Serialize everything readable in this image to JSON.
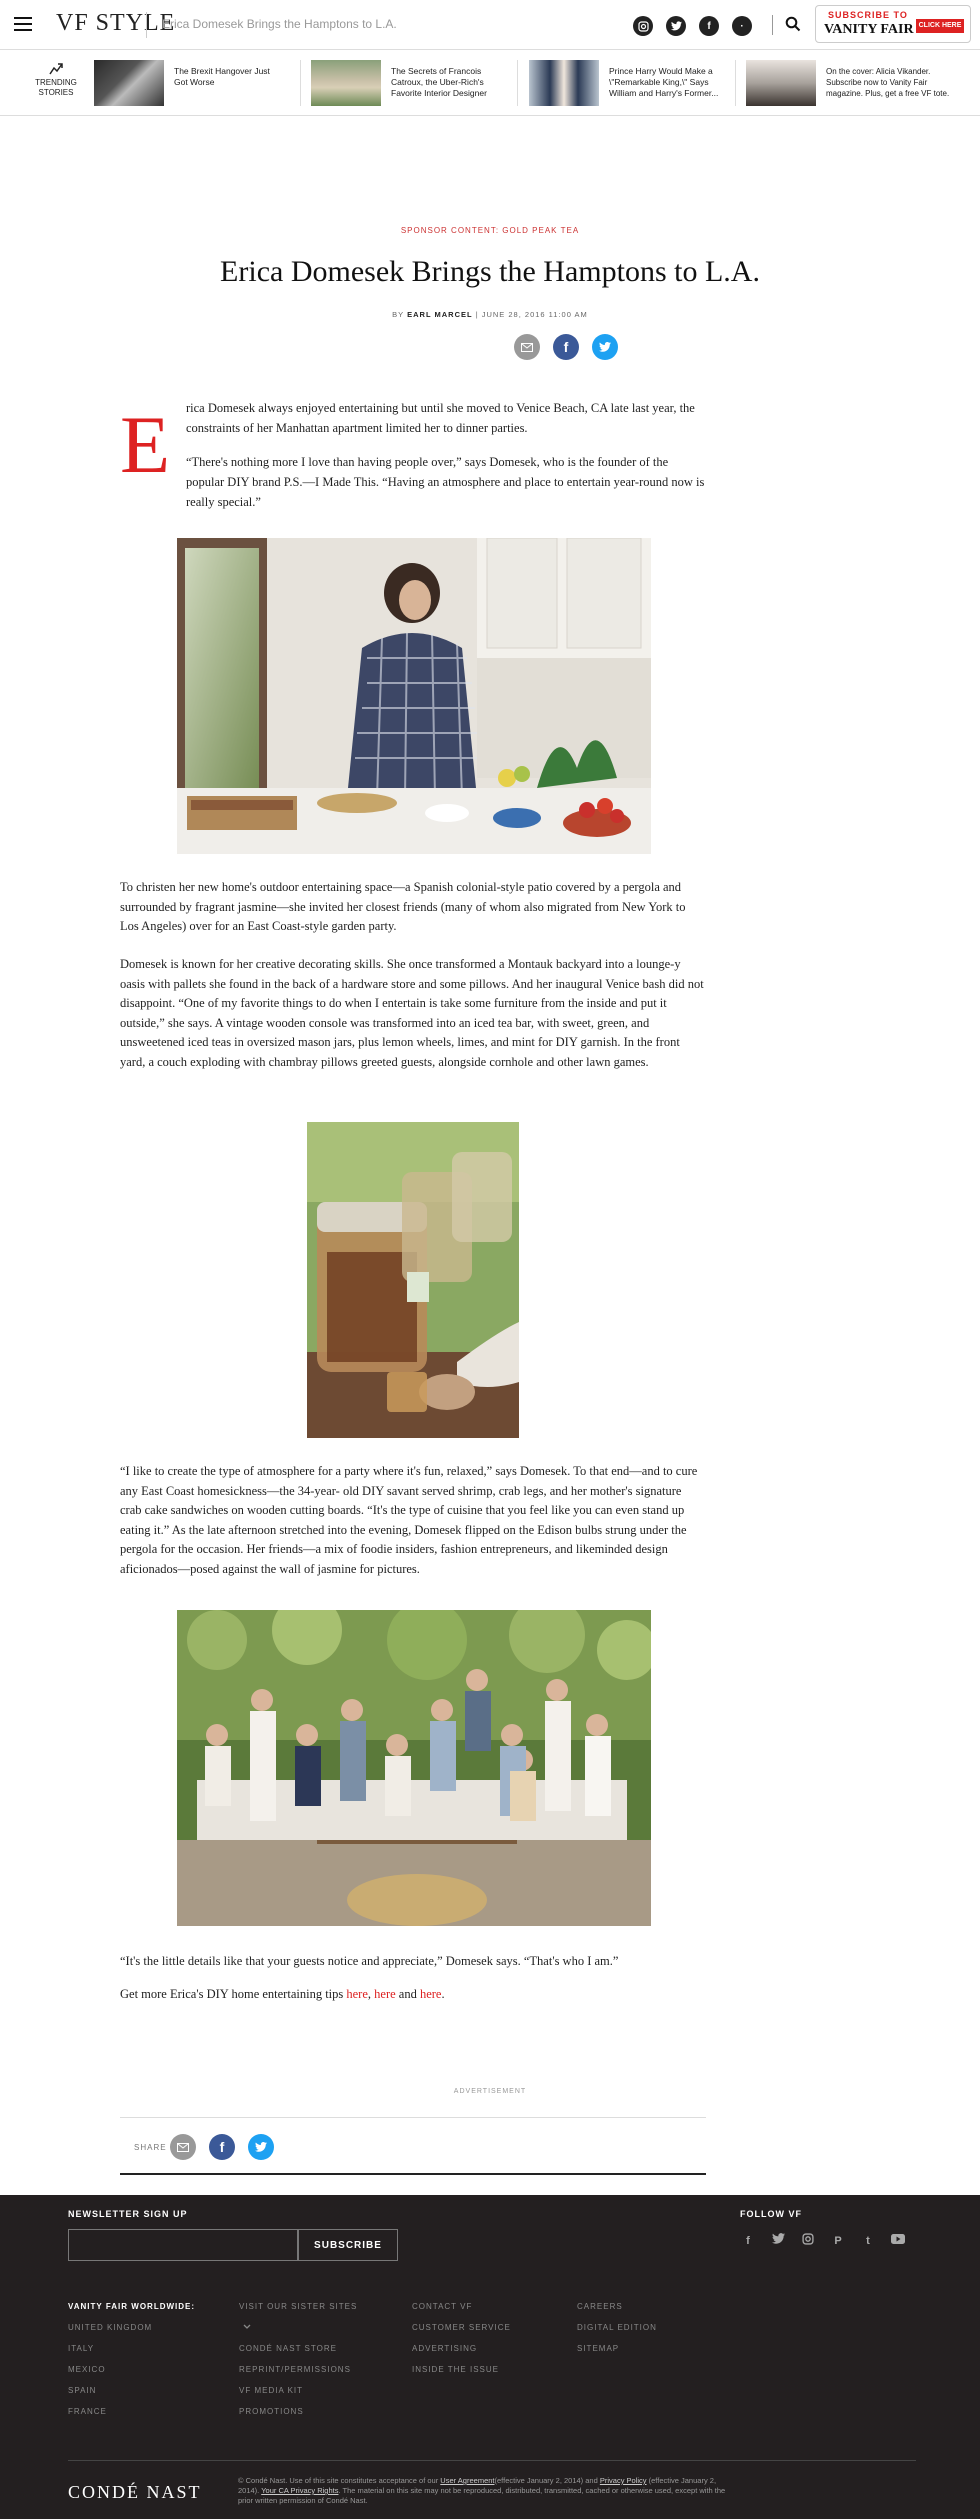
{
  "header": {
    "logo": "VF STYLE",
    "article_title": "Erica Domesek Brings the Hamptons to L.A.",
    "social": [
      "instagram",
      "twitter",
      "facebook",
      "more"
    ],
    "subscribe_line1": "SUBSCRIBE TO",
    "subscribe_line2": "VANITY FAIR",
    "subscribe_cta": "CLICK HERE"
  },
  "trending": {
    "label": "TRENDING STORIES",
    "items": [
      {
        "text": "The Brexit Hangover Just Got Worse"
      },
      {
        "text": "The Secrets of Francois Catroux, the Uber-Rich's Favorite Interior Designer"
      },
      {
        "text": "Prince Harry Would Make a \\\"Remarkable King,\\\" Says William and Harry's Former..."
      },
      {
        "text": "On the cover: Alicia Vikander. Subscribe now to Vanity Fair magazine. Plus, get a free VF tote."
      }
    ]
  },
  "article": {
    "sponsor": "SPONSOR CONTENT: GOLD PEAK TEA",
    "title": "Erica Domesek Brings the Hamptons to L.A.",
    "by": "BY",
    "author": "EARL MARCEL",
    "date": "| JUNE 28, 2016 11:00 AM",
    "dropcap": "E",
    "p1": "rica Domesek always enjoyed entertaining but until she moved to Venice Beach, CA late last year, the constraints of her Manhattan apartment limited her to dinner parties.",
    "p2": "“There's nothing more I love than having people over,” says Domesek, who is the founder of the popular DIY brand P.S.—I Made This. “Having an atmosphere and place to entertain year-round now is really special.”",
    "p3": "To christen her new home's outdoor entertaining space—a Spanish colonial-style patio covered by a pergola and surrounded by fragrant jasmine—she invited her closest friends (many of whom also migrated from New York to Los Angeles) over for an East Coast-style garden party.",
    "p4": "Domesek is known for her creative decorating skills. She once transformed a Montauk backyard into a lounge-y oasis with pallets she found in the back of a hardware store and some pillows. And her inaugural Venice bash did not disappoint. “One of my favorite things to do when I entertain is take some furniture from the inside and put it outside,” she says. A vintage wooden console was transformed into an iced tea bar, with sweet, green, and unsweetened iced teas in oversized mason jars, plus lemon wheels, limes, and mint for DIY garnish. In the front yard, a couch exploding with chambray pillows greeted guests, alongside cornhole and other lawn games.",
    "p5": "“I like to create the type of atmosphere for a party where it's fun, relaxed,” says Domesek. To that end—and to cure any East Coast homesickness—the 34-year- old DIY savant served shrimp, crab legs, and her mother's signature crab cake sandwiches on wooden cutting boards. “It's the type of cuisine that you feel like you can even stand up eating it.” As the late afternoon stretched into the evening, Domesek flipped on the Edison bulbs strung under the pergola for the occasion. Her friends—a mix of foodie insiders, fashion entrepreneurs, and likeminded design aficionados—posed against the wall of jasmine for pictures.",
    "p6": "“It's the little details like that your guests notice and appreciate,” Domesek says. “That's who I am.”",
    "p7_prefix": "Get more Erica's DIY home entertaining tips ",
    "link1": "here",
    "sep1": ", ",
    "link2": "here",
    "sep2": " and ",
    "link3": "here",
    "p7_suffix": "."
  },
  "advertisement": "ADVERTISEMENT",
  "share_label": "SHARE",
  "footer": {
    "newsletter_label": "NEWSLETTER SIGN UP",
    "email_value": "",
    "subscribe_button": "SUBSCRIBE",
    "follow_label": "FOLLOW VF",
    "col1": [
      "VANITY FAIR WORLDWIDE:",
      "UNITED KINGDOM",
      "ITALY",
      "MEXICO",
      "SPAIN",
      "FRANCE"
    ],
    "col2": [
      "VISIT OUR SISTER SITES",
      "",
      "CONDÉ NAST STORE",
      "REPRINT/PERMISSIONS",
      "VF MEDIA KIT",
      "PROMOTIONS"
    ],
    "col3": [
      "CONTACT VF",
      "CUSTOMER SERVICE",
      "ADVERTISING",
      "INSIDE THE ISSUE"
    ],
    "col4": [
      "CAREERS",
      "DIGITAL EDITION",
      "SITEMAP"
    ],
    "conde": "CONDÉ NAST",
    "legal_1": "© Condé Nast. Use of this site constitutes acceptance of our ",
    "legal_ua": "User Agreement",
    "legal_2": "(effective January 2, 2014) and ",
    "legal_pp": "Privacy Policy",
    "legal_3": " (effective January 2, 2014). ",
    "legal_ca": "Your CA Privacy Rights",
    "legal_4": ". The material on this site may not be reproduced, distributed, transmitted, cached or otherwise used, except with the prior written permission of Condé Nast."
  }
}
